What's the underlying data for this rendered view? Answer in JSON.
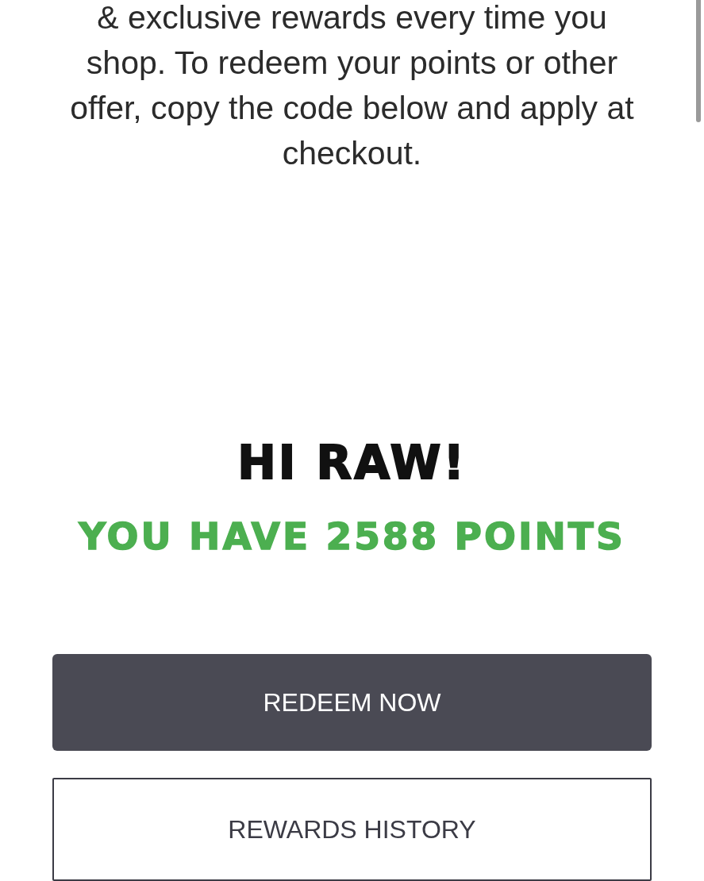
{
  "intro": "& exclusive rewards every time you shop. To redeem your points or other offer, copy the code below and apply at checkout.",
  "greeting": "HI RAW!",
  "points_line": "YOU HAVE 2588 POINTS",
  "buttons": [
    {
      "label": "REDEEM NOW",
      "kind": "primary"
    },
    {
      "label": "REWARDS HISTORY",
      "kind": "outline"
    }
  ]
}
